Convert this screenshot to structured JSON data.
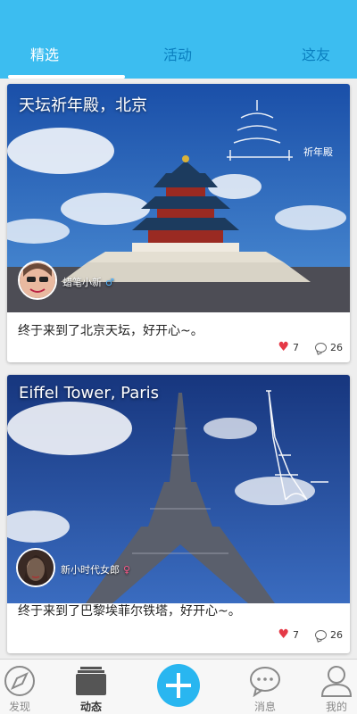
{
  "top_tabs": [
    {
      "label": "精选",
      "active": true
    },
    {
      "label": "活动",
      "active": false
    },
    {
      "label": "这友",
      "active": false
    }
  ],
  "posts": [
    {
      "photo_title": "天坛祈年殿，北京",
      "photo_watermark": "祈年殿",
      "author": "蜡笔小新",
      "gender": "male",
      "text": "终于来到了北京天坛，好开心~。",
      "likes": "7",
      "comments": "26"
    },
    {
      "photo_title": "Eiffel Tower, Paris",
      "author": "新小时代女郎",
      "gender": "female",
      "text": "终于来到了巴黎埃菲尔铁塔，好开心~。",
      "likes": "7",
      "comments": "26"
    }
  ],
  "bottom_nav": [
    {
      "label": "发现",
      "icon": "compass-icon",
      "active": false
    },
    {
      "label": "动态",
      "icon": "stack-icon",
      "active": true
    },
    {
      "label": "",
      "icon": "plus-icon",
      "active": false
    },
    {
      "label": "消息",
      "icon": "chat-icon",
      "active": false
    },
    {
      "label": "我的",
      "icon": "user-icon",
      "active": false
    }
  ],
  "colors": {
    "accent": "#3cbdf0",
    "tab_inactive": "#0a7fbf",
    "like": "#e53947"
  }
}
